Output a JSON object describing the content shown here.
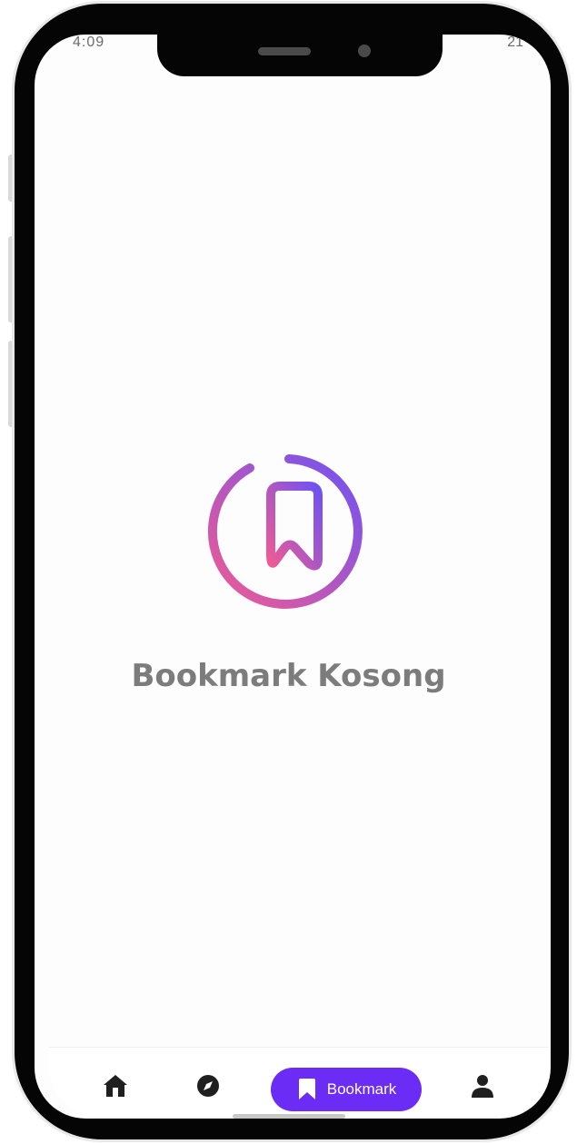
{
  "status_bar": {
    "time": "4:09",
    "right": "21"
  },
  "empty_state": {
    "message": "Bookmark Kosong",
    "icon": "bookmark-circle-icon"
  },
  "bottom_nav": {
    "items": [
      {
        "icon": "home-icon",
        "label": ""
      },
      {
        "icon": "compass-icon",
        "label": ""
      },
      {
        "icon": "bookmark-icon",
        "label": "Bookmark",
        "active": true
      },
      {
        "icon": "user-icon",
        "label": ""
      }
    ]
  },
  "colors": {
    "accent": "#6b2cf5",
    "gradient_start": "#e5569b",
    "gradient_end": "#7b4cf3",
    "muted_text": "#7c7c7c"
  }
}
